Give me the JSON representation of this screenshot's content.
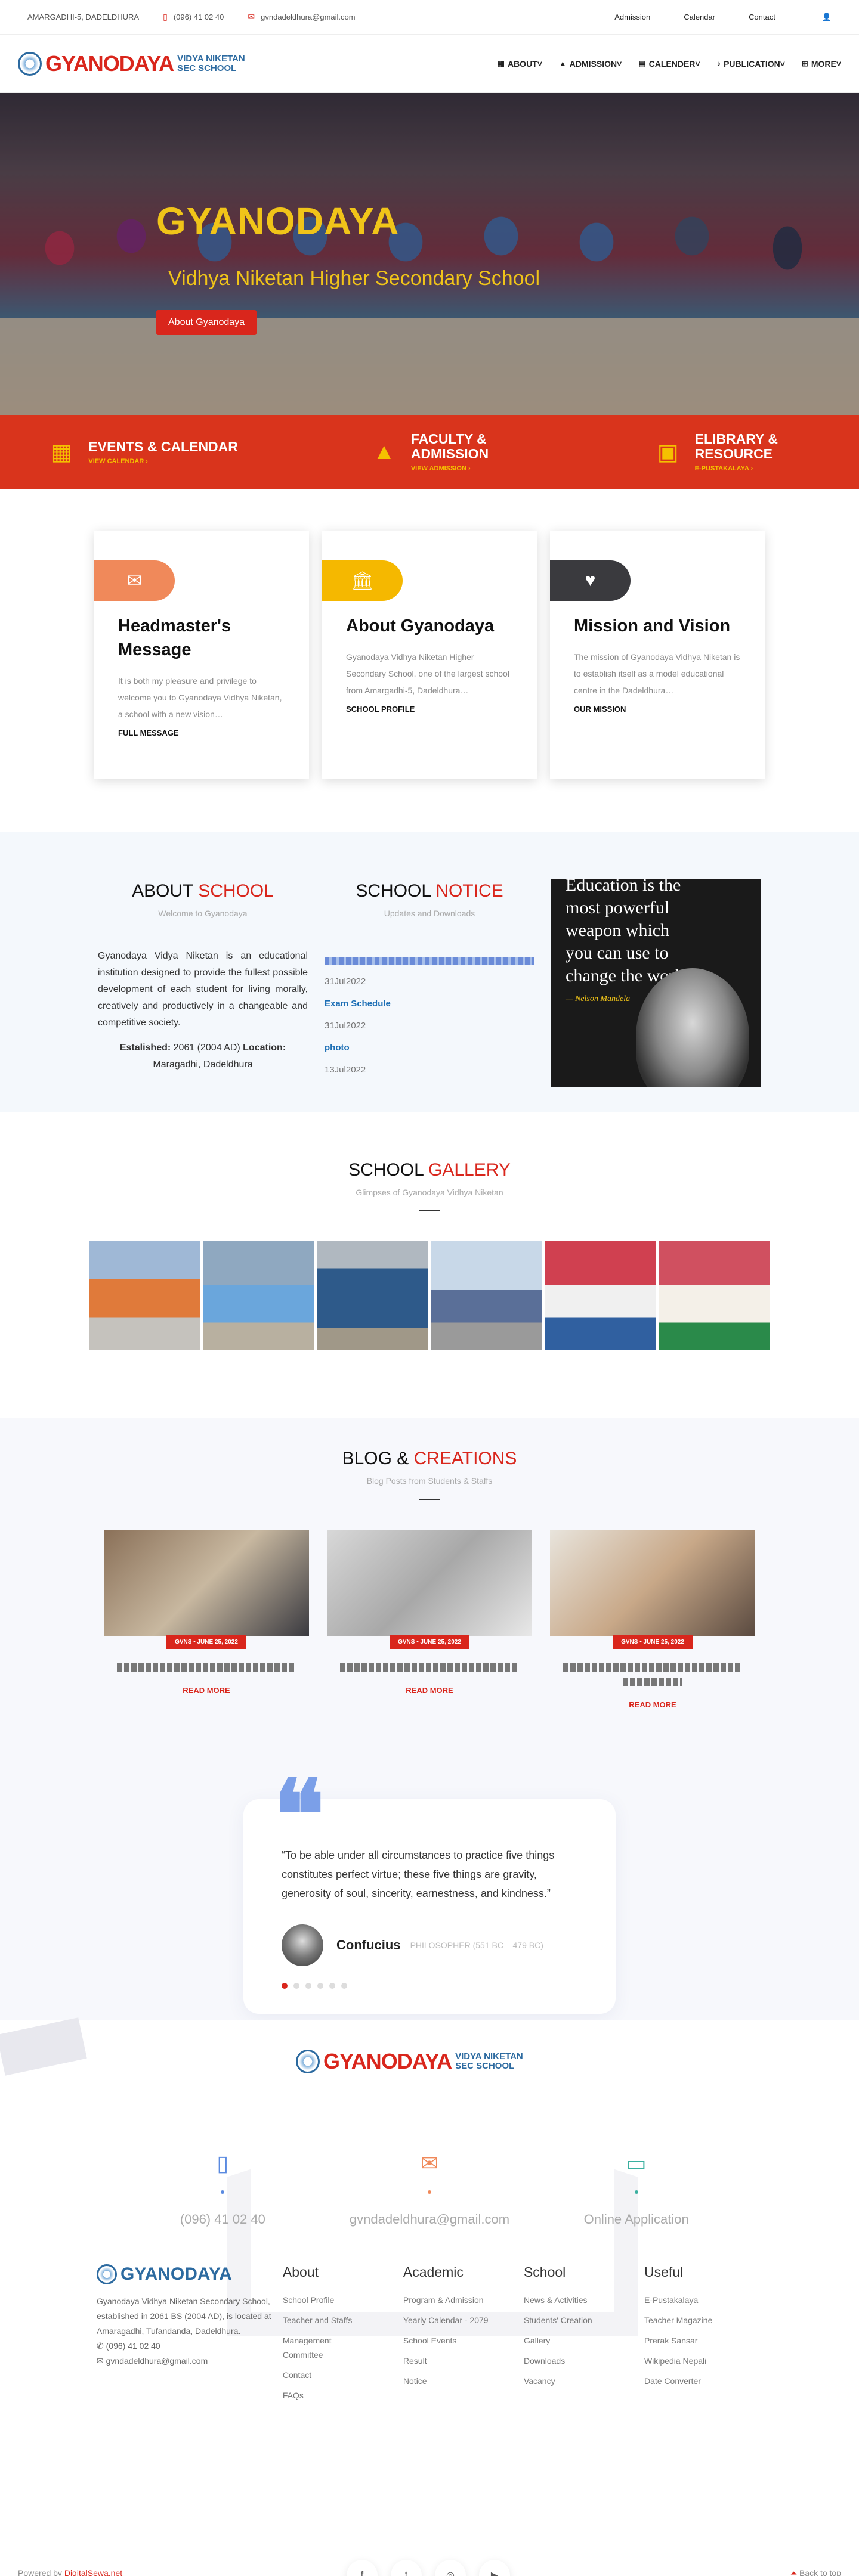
{
  "topbar": {
    "address": "AMARGADHI-5, DADELDHURA",
    "phone": "(096) 41 02 40",
    "email": "gvndadeldhura@gmail.com",
    "links": [
      "Admission",
      "Calendar",
      "Contact"
    ],
    "user_icon": "user-icon"
  },
  "header": {
    "logo_big": "GYANODAYA",
    "logo_line1": "VIDYA NIKETAN",
    "logo_line2": "SEC SCHOOL",
    "nav": [
      {
        "label": "ABOUT",
        "icon": "building-icon"
      },
      {
        "label": "ADMISSION",
        "icon": "graduation-cap-icon"
      },
      {
        "label": "CALENDER",
        "icon": "calendar-icon"
      },
      {
        "label": "PUBLICATION",
        "icon": "bell-icon"
      },
      {
        "label": "MORE",
        "icon": "plus-square-icon"
      }
    ]
  },
  "hero": {
    "title": "GYANODAYA",
    "subtitle": "Vidhya Niketan Higher Secondary School",
    "button": "About Gyanodaya"
  },
  "features": [
    {
      "title1": "EVENTS & CALENDAR",
      "title2": "",
      "sub": "VIEW CALENDAR ›"
    },
    {
      "title1": "FACULTY &",
      "title2": "ADMISSION",
      "sub": "VIEW ADMISSION ›"
    },
    {
      "title1": "ELIBRARY &",
      "title2": "RESOURCE",
      "sub": "E-PUSTAKALAYA ›"
    }
  ],
  "cards": [
    {
      "title": "Headmaster's Message",
      "text": "It is both my pleasure and privilege to welcome you to Gyanodaya Vidhya Niketan, a school with a new vision…",
      "more": "FULL MESSAGE",
      "color": "#f0895a",
      "icon": "envelope-icon"
    },
    {
      "title": "About Gyanodaya",
      "text": "Gyanodaya Vidhya Niketan Higher Secondary School, one of the largest school from Amargadhi-5, Dadeldhura…",
      "more": "SCHOOL PROFILE",
      "color": "#f5b800",
      "icon": "institution-icon"
    },
    {
      "title": "Mission and Vision",
      "text": "The mission of Gyanodaya Vidhya Niketan is to establish itself as a model educational centre in the Dadeldhura…",
      "more": "OUR MISSION",
      "color": "#3a3a3e",
      "icon": "heart-icon"
    }
  ],
  "about": {
    "title_a": "ABOUT ",
    "title_b": "SCHOOL",
    "sub": "Welcome to Gyanodaya",
    "text": "Gyanodaya Vidya Niketan is an educational institution designed to provide the fullest possible development of each student for living morally, creatively and productively in a changeable and competitive society.",
    "estab_label": "Estalished:",
    "estab_val": " 2061 (2004 AD) ",
    "loc_label": "Location:",
    "loc_val": "Maragadhi, Dadeldhura"
  },
  "notice": {
    "title_a": "SCHOOL ",
    "title_b": "NOTICE",
    "sub": "Updates and Downloads",
    "items": [
      {
        "date": "31Jul2022",
        "link": "Exam Schedule"
      },
      {
        "date": "31Jul2022",
        "link": "photo"
      },
      {
        "date": "13Jul2022",
        "link": ""
      }
    ]
  },
  "quote_img": {
    "text": "Education is the most powerful weapon which you can use to change the world.",
    "author": "— Nelson Mandela"
  },
  "gallery": {
    "title_a": "SCHOOL ",
    "title_b": "GALLERY",
    "sub": "Glimpses of Gyanodaya Vidhya Niketan"
  },
  "blog": {
    "title_a": "BLOG & ",
    "title_b": "CREATIONS",
    "sub": "Blog Posts from Students & Staffs",
    "posts": [
      {
        "author": "GVNS",
        "date": "JUNE 25, 2022",
        "more": "READ MORE"
      },
      {
        "author": "GVNS",
        "date": "JUNE 25, 2022",
        "more": "READ MORE"
      },
      {
        "author": "GVNS",
        "date": "JUNE 25, 2022",
        "more": "READ MORE"
      }
    ]
  },
  "testimonial": {
    "quote": "“To be able under all circumstances to practice five things constitutes perfect virtue; these five things are gravity, generosity of soul, sincerity, earnestness, and kindness.”",
    "name": "Confucius",
    "role": "PHILOSOPHER (551 BC – 479 BC)"
  },
  "footer": {
    "logo_big": "GYANODAYA",
    "logo_line1": "VIDYA NIKETAN",
    "logo_line2": "SEC SCHOOL",
    "phone": "(096) 41 02 40",
    "email": "gvndadeldhura@gmail.com",
    "online": "Online Application",
    "about_text": "Gyanodaya Vidhya Niketan Secondary School, established in 2061 BS (2004 AD), is located at Amaragadhi, Tufandanda, Dadeldhura.",
    "about_phone": "✆ (096) 41 02 40",
    "about_email": "✉ gvndadeldhura@gmail.com",
    "cols": [
      {
        "head": "About",
        "items": [
          "School Profile",
          "Teacher and Staffs",
          "Management Committee",
          "Contact",
          "FAQs"
        ]
      },
      {
        "head": "Academic",
        "items": [
          "Program & Admission",
          "Yearly Calendar - 2079",
          "School Events",
          "Result",
          "Notice"
        ]
      },
      {
        "head": "School",
        "items": [
          "News & Activities",
          "Students' Creation",
          "Gallery",
          "Downloads",
          "Vacancy"
        ]
      },
      {
        "head": "Useful",
        "items": [
          "E-Pustakalaya",
          "Teacher Magazine",
          "Prerak Sansar",
          "Wikipedia Nepali",
          "Date Converter"
        ]
      }
    ],
    "powered_a": "Powered by ",
    "powered_b": "DigitalSewa.net",
    "back_top": "Back to top"
  }
}
